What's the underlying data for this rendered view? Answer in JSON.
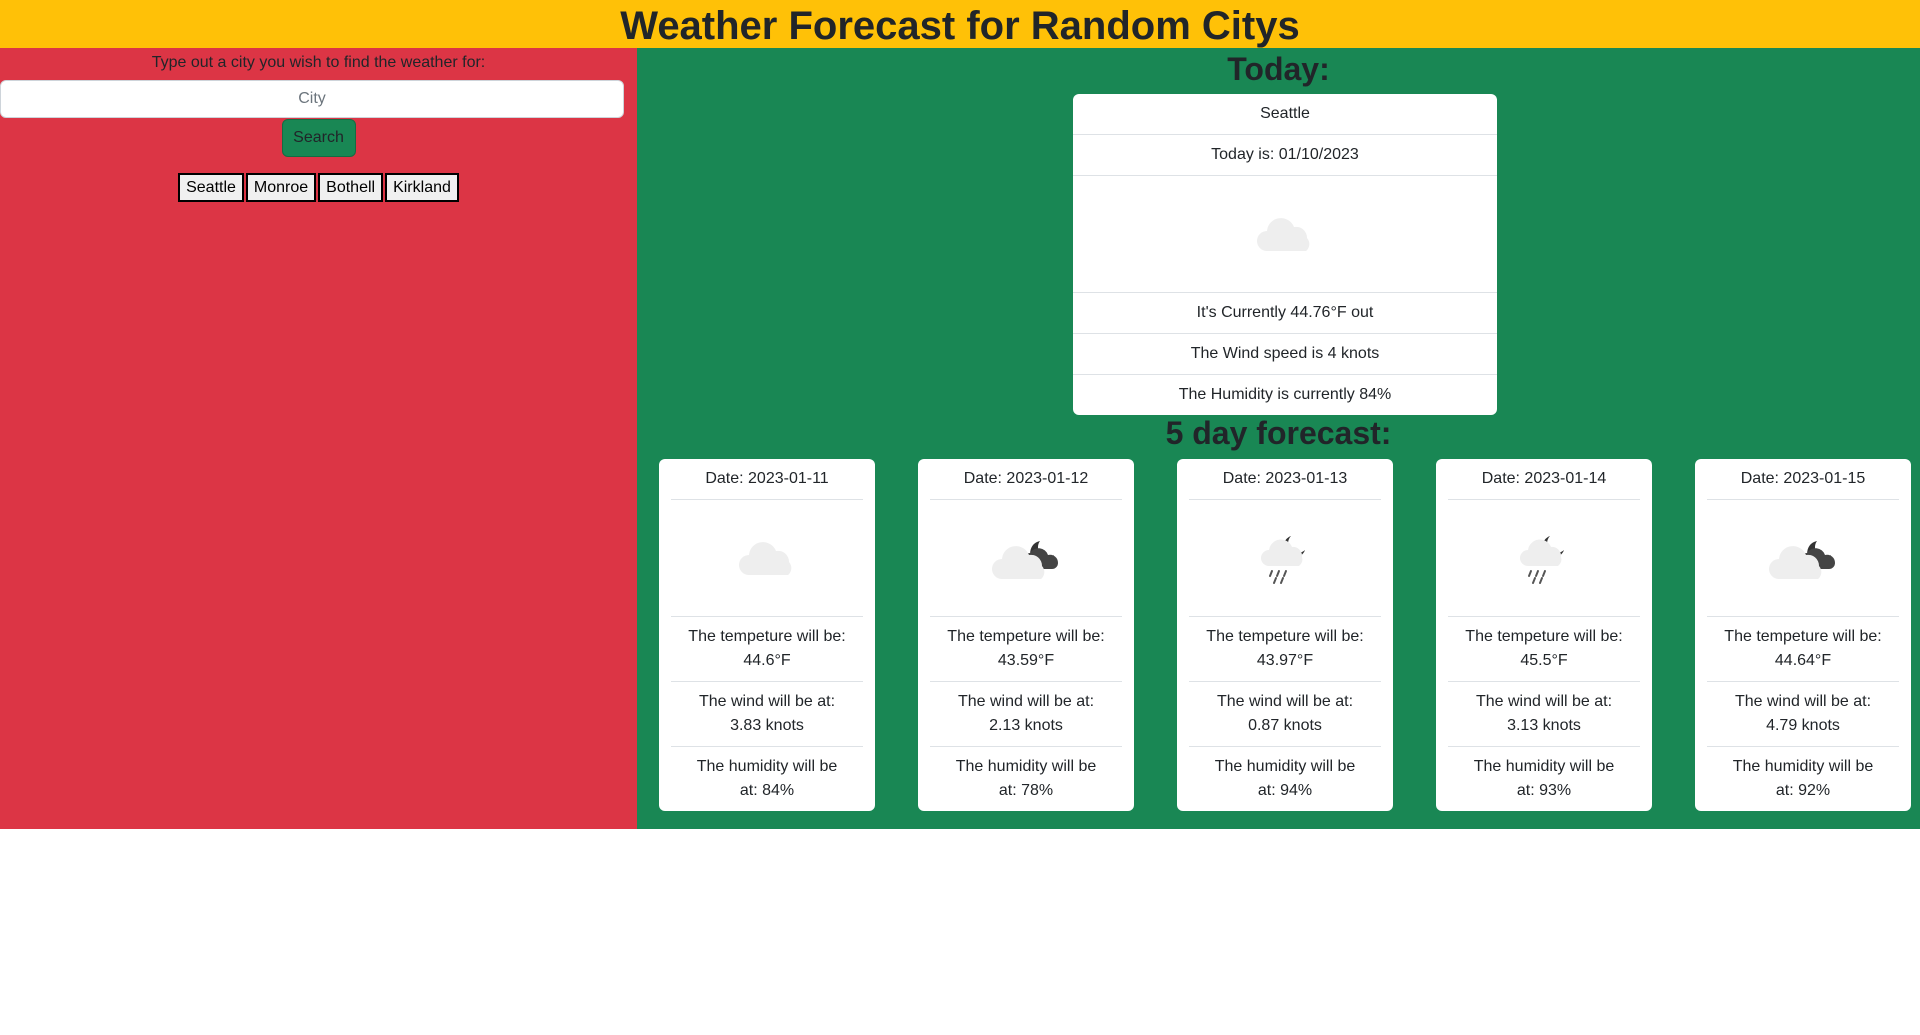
{
  "header": {
    "title": "Weather Forecast for Random Citys"
  },
  "search": {
    "prompt": "Type out a city you wish to find the weather for:",
    "placeholder": "City",
    "button_label": "Search",
    "history": [
      "Seattle",
      "Monroe",
      "Bothell",
      "Kirkland"
    ]
  },
  "today": {
    "heading": "Today:",
    "city": "Seattle",
    "date_text": "Today is: 01/10/2023",
    "icon": "cloud-icon",
    "temp_text": "It's Currently 44.76°F out",
    "wind_text": "The Wind speed is 4 knots",
    "humidity_text": "The Humidity is currently 84%"
  },
  "forecast": {
    "heading": "5 day forecast:",
    "days": [
      {
        "date": "Date: 2023-01-11",
        "icon": "cloud-icon",
        "temp_1": "The tempeture will be:",
        "temp_2": "44.6°F",
        "wind_1": "The wind will be at:",
        "wind_2": "3.83 knots",
        "hum_1": "The humidity will be",
        "hum_2": "at: 84%"
      },
      {
        "date": "Date: 2023-01-12",
        "icon": "cloudy-night-icon",
        "temp_1": "The tempeture will be:",
        "temp_2": "43.59°F",
        "wind_1": "The wind will be at:",
        "wind_2": "2.13 knots",
        "hum_1": "The humidity will be",
        "hum_2": "at: 78%"
      },
      {
        "date": "Date: 2023-01-13",
        "icon": "rain-night-icon",
        "temp_1": "The tempeture will be:",
        "temp_2": "43.97°F",
        "wind_1": "The wind will be at:",
        "wind_2": "0.87 knots",
        "hum_1": "The humidity will be",
        "hum_2": "at: 94%"
      },
      {
        "date": "Date: 2023-01-14",
        "icon": "rain-night-icon",
        "temp_1": "The tempeture will be:",
        "temp_2": "45.5°F",
        "wind_1": "The wind will be at:",
        "wind_2": "3.13 knots",
        "hum_1": "The humidity will be",
        "hum_2": "at: 93%"
      },
      {
        "date": "Date: 2023-01-15",
        "icon": "cloudy-night-icon",
        "temp_1": "The tempeture will be:",
        "temp_2": "44.64°F",
        "wind_1": "The wind will be at:",
        "wind_2": "4.79 knots",
        "hum_1": "The humidity will be",
        "hum_2": "at: 92%"
      }
    ]
  },
  "colors": {
    "header": "#ffc107",
    "left_panel": "#dc3545",
    "right_panel": "#198754",
    "search_button": "#198754"
  }
}
